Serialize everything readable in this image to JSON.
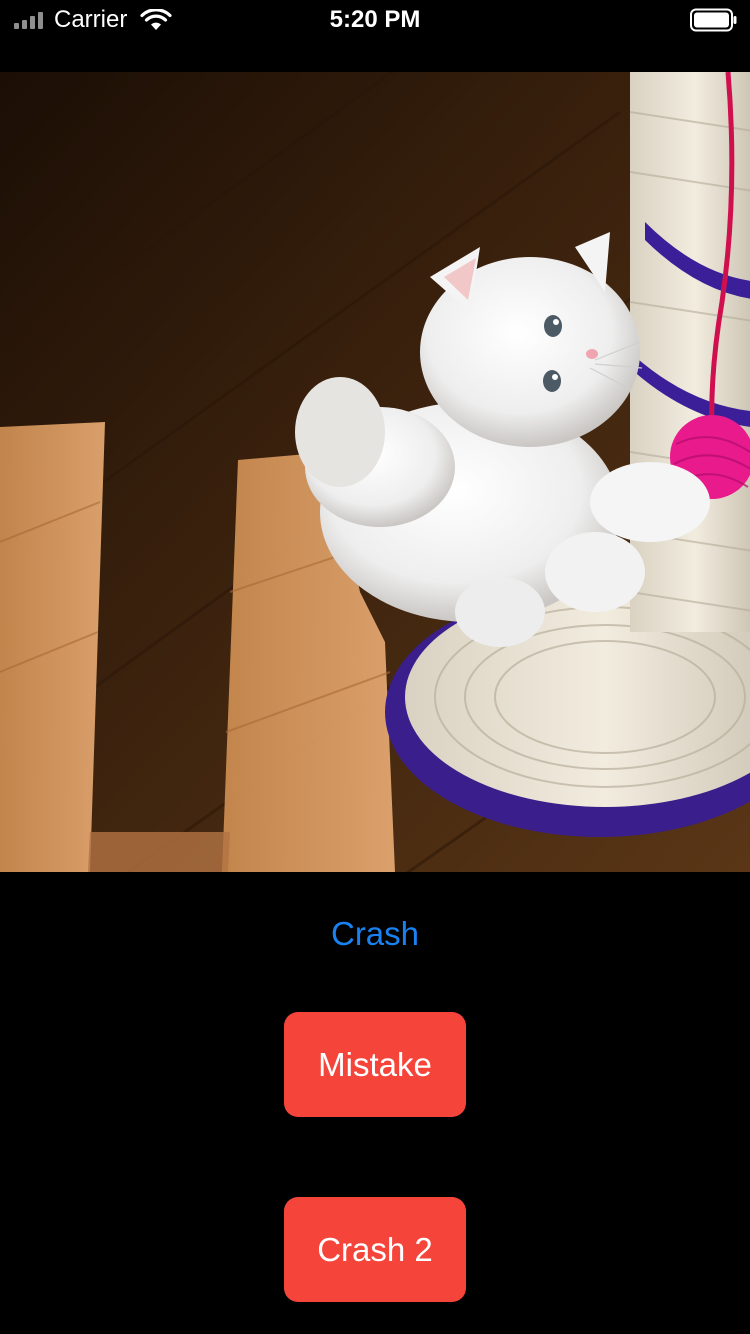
{
  "status_bar": {
    "carrier": "Carrier",
    "time": "5:20 PM",
    "icons": [
      "signal-icon",
      "wifi-icon",
      "battery-icon"
    ]
  },
  "photo": {
    "icon": "kitten-photo"
  },
  "buttons": {
    "crash_label": "Crash",
    "mistake_label": "Mistake",
    "crash2_label": "Crash 2"
  },
  "colors": {
    "link_blue": "#1a82f0",
    "button_red": "#f5453a",
    "background": "#000000"
  }
}
